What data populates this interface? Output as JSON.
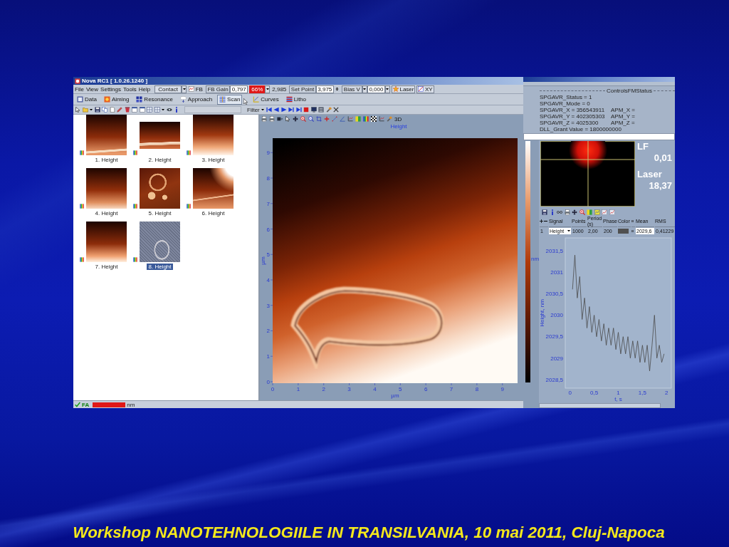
{
  "main_window": {
    "title": "Nova RC1 [ 1.0.26.1240 ]",
    "menu": [
      "File",
      "View",
      "Settings",
      "Tools",
      "Help"
    ],
    "controls": {
      "mode": "Contact",
      "fb": "FB",
      "fb_gain_label": "FB Gain",
      "fb_gain": "0,797",
      "indicator": "66%",
      "reading": "2,985",
      "set_point_label": "Set Point",
      "set_point": "3,975",
      "bias_label": "Bias V",
      "bias": "0,000",
      "laser": "Laser",
      "xy": "XY"
    },
    "mode_buttons": [
      {
        "label": "Data",
        "selected": false
      },
      {
        "label": "Aiming",
        "selected": false
      },
      {
        "label": "Resonance",
        "selected": false
      },
      {
        "label": "Approach",
        "selected": false
      },
      {
        "label": "Scan",
        "selected": true
      },
      {
        "label": "Curves",
        "selected": false
      },
      {
        "label": "Litho",
        "selected": false
      }
    ],
    "filter_label": "Filter",
    "thumbnails": [
      {
        "label": "1. Height",
        "selected": false
      },
      {
        "label": "2. Height",
        "selected": false
      },
      {
        "label": "3. Height",
        "selected": false
      },
      {
        "label": "4. Height",
        "selected": false
      },
      {
        "label": "5. Height",
        "selected": false
      },
      {
        "label": "6. Height",
        "selected": false
      },
      {
        "label": "7. Height",
        "selected": false
      },
      {
        "label": "8. Height",
        "selected": true
      }
    ],
    "image_view": {
      "title": "Height",
      "view_3d": "3D",
      "x_ticks": [
        "0",
        "1",
        "2",
        "3",
        "4",
        "5",
        "6",
        "7",
        "8",
        "9"
      ],
      "y_ticks": [
        "9",
        "8",
        "7",
        "6",
        "5",
        "4",
        "3",
        "2",
        "1",
        "0"
      ],
      "x_unit": "µm",
      "y_unit": "µm",
      "colorbar_unit": "nm"
    },
    "status_bar": {
      "state": "FA",
      "unit": "nm"
    }
  },
  "status_window": {
    "group_title": "ControlsFMStatus",
    "lines": [
      {
        "left": "SPGAVR_Status = 1"
      },
      {
        "left": "SPGAVR_Mode = 0"
      },
      {
        "left": "SPGAVR_X = 356543911",
        "right": "APM_X ="
      },
      {
        "left": "SPGAVR_Y = 402305303",
        "right": "APM_Y ="
      },
      {
        "left": "SPGAVR_Z = 4025300",
        "right": "APM_Z ="
      },
      {
        "left": "DLL_Grant Value = 1800000000"
      }
    ]
  },
  "curve_panel": {
    "laser": {
      "lf_label": "LF",
      "lf_value": "0,01",
      "laser_label": "Laser",
      "laser_value": "18,37"
    },
    "table": {
      "columns": [
        "Signal",
        "Points",
        "Period (s)",
        "Phase",
        "Color",
        "Mean",
        "RMS"
      ],
      "rows": [
        {
          "index": "1",
          "signal": "Height",
          "points": "1000",
          "period": "2,00",
          "phase": "200",
          "color": "#505050",
          "mean": "2029,6",
          "rms": "0,41229"
        }
      ]
    },
    "chart_data": {
      "type": "line",
      "xlabel": "t, s",
      "ylabel": "Height, nm",
      "x": [
        0.05,
        0.1,
        0.15,
        0.2,
        0.25,
        0.3,
        0.35,
        0.4,
        0.45,
        0.5,
        0.55,
        0.6,
        0.65,
        0.7,
        0.75,
        0.8,
        0.85,
        0.9,
        0.95,
        1.0,
        1.05,
        1.1,
        1.15,
        1.2,
        1.25,
        1.3,
        1.35,
        1.4,
        1.45,
        1.5,
        1.55,
        1.6,
        1.65,
        1.7,
        1.75,
        1.8,
        1.85,
        1.9,
        1.95
      ],
      "series": [
        {
          "color": "#4a4a4a",
          "values": [
            2030.6,
            2031.4,
            2030.4,
            2030.9,
            2029.9,
            2030.4,
            2029.7,
            2030.2,
            2029.6,
            2030.0,
            2029.5,
            2029.9,
            2029.4,
            2029.8,
            2029.3,
            2029.7,
            2029.3,
            2029.7,
            2029.2,
            2029.6,
            2029.1,
            2029.5,
            2029.1,
            2029.5,
            2029.0,
            2029.4,
            2029.0,
            2029.4,
            2028.9,
            2029.3,
            2028.9,
            2029.3,
            2028.7,
            2029.3,
            2030.0,
            2029.0,
            2029.3,
            2028.9,
            2029.1
          ]
        }
      ],
      "xlim": [
        -0.1,
        2.1
      ],
      "ylim": [
        2028.3,
        2031.8
      ],
      "xticks": [
        {
          "value": 0,
          "label": "0"
        },
        {
          "value": 0.5,
          "label": "0,5"
        },
        {
          "value": 1,
          "label": "1"
        },
        {
          "value": 1.5,
          "label": "1,5"
        },
        {
          "value": 2,
          "label": "2"
        }
      ],
      "yticks": [
        {
          "value": 2028.5,
          "label": "2028,5"
        },
        {
          "value": 2029,
          "label": "2029"
        },
        {
          "value": 2029.5,
          "label": "2029,5"
        },
        {
          "value": 2030,
          "label": "2030"
        },
        {
          "value": 2030.5,
          "label": "2030,5"
        },
        {
          "value": 2031,
          "label": "2031"
        },
        {
          "value": 2031.5,
          "label": "2031,5"
        }
      ]
    }
  },
  "caption": "Workshop NANOTEHNOLOGIILE IN TRANSILVANIA, 10 mai 2011, Cluj-Napoca"
}
